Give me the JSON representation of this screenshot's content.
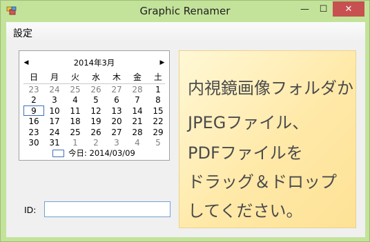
{
  "window": {
    "title": "Graphic Renamer",
    "controls": {
      "minimize": "—",
      "maximize": "☐",
      "close": "✕"
    }
  },
  "menu": {
    "items": [
      "設定"
    ]
  },
  "calendar": {
    "month_label": "2014年3月",
    "weekdays": [
      "日",
      "月",
      "火",
      "水",
      "木",
      "金",
      "土"
    ],
    "weeks": [
      [
        "23",
        "24",
        "25",
        "26",
        "27",
        "28",
        "1"
      ],
      [
        "2",
        "3",
        "4",
        "5",
        "6",
        "7",
        "8"
      ],
      [
        "9",
        "10",
        "11",
        "12",
        "13",
        "14",
        "15"
      ],
      [
        "16",
        "17",
        "18",
        "19",
        "20",
        "21",
        "22"
      ],
      [
        "23",
        "24",
        "25",
        "26",
        "27",
        "28",
        "29"
      ],
      [
        "30",
        "31",
        "1",
        "2",
        "3",
        "4",
        "5"
      ]
    ],
    "muted": [
      [
        true,
        true,
        true,
        true,
        true,
        true,
        false
      ],
      [
        false,
        false,
        false,
        false,
        false,
        false,
        false
      ],
      [
        false,
        false,
        false,
        false,
        false,
        false,
        false
      ],
      [
        false,
        false,
        false,
        false,
        false,
        false,
        false
      ],
      [
        false,
        false,
        false,
        false,
        false,
        false,
        false
      ],
      [
        false,
        false,
        true,
        true,
        true,
        true,
        true
      ]
    ],
    "selected_day": "9",
    "today_label": "今日: 2014/03/09"
  },
  "id_field": {
    "label": "ID:",
    "value": ""
  },
  "drop_zone": {
    "lines": [
      "内視鏡画像フォルダか",
      "JPEGファイル、",
      "PDFファイルを",
      "ドラッグ＆ドロップ",
      "してください。"
    ]
  },
  "colors": {
    "titlebar": "#c3e39a",
    "close_button": "#c75050",
    "drop_zone": "#ffe9a8",
    "selection": "#3b6fb5"
  }
}
